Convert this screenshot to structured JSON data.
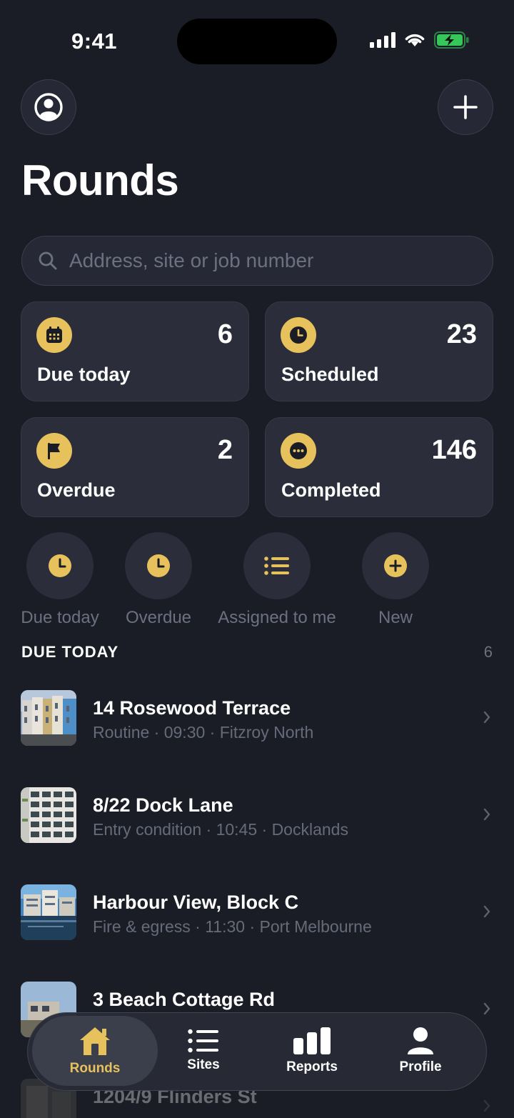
{
  "status": {
    "time": "9:41"
  },
  "header": {
    "title": "Rounds"
  },
  "search": {
    "placeholder": "Address, site or job number"
  },
  "stats": [
    {
      "label": "Due today",
      "count": "6",
      "icon": "calendar-icon"
    },
    {
      "label": "Scheduled",
      "count": "23",
      "icon": "clock-icon"
    },
    {
      "label": "Overdue",
      "count": "2",
      "icon": "flag-icon"
    },
    {
      "label": "Completed",
      "count": "146",
      "icon": "more-icon"
    }
  ],
  "quick_filters": [
    {
      "label": "Due today",
      "icon": "clock-icon"
    },
    {
      "label": "Overdue",
      "icon": "clock-icon"
    },
    {
      "label": "Assigned to me",
      "icon": "list-icon"
    },
    {
      "label": "New",
      "icon": "plus-circle-icon"
    }
  ],
  "section": {
    "title": "DUE TODAY",
    "count": "6"
  },
  "rounds": [
    {
      "title": "14 Rosewood Terrace",
      "subtitle": "Routine · 09:30 · Fitzroy North"
    },
    {
      "title": "8/22 Dock Lane",
      "subtitle": "Entry condition · 10:45 · Docklands"
    },
    {
      "title": "Harbour View, Block C",
      "subtitle": "Fire & egress · 11:30 · Port Melbourne"
    },
    {
      "title": "3 Beach Cottage Rd",
      "subtitle": ""
    },
    {
      "title": "1204/9 Flinders St",
      "subtitle": ""
    }
  ],
  "tabs": [
    {
      "label": "Rounds",
      "icon": "home-icon",
      "active": true
    },
    {
      "label": "Sites",
      "icon": "list-icon"
    },
    {
      "label": "Reports",
      "icon": "bar-chart-icon"
    },
    {
      "label": "Profile",
      "icon": "person-icon"
    }
  ],
  "colors": {
    "background": "#1b1d26",
    "card": "#2b2e3a",
    "accent": "#e7c15c",
    "battery": "#35c759"
  }
}
